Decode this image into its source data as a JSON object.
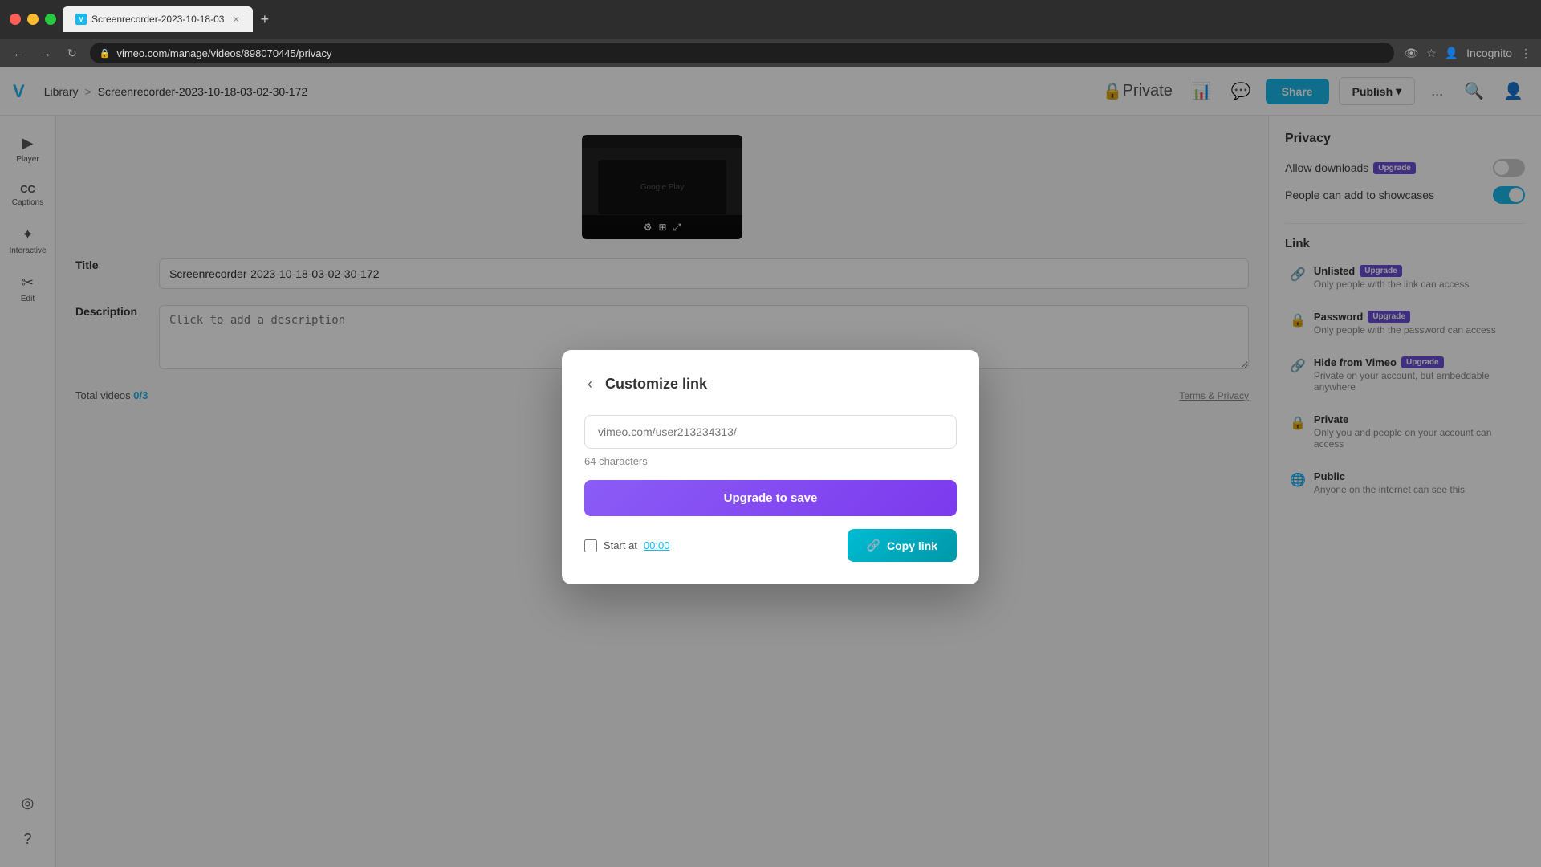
{
  "browser": {
    "tab_title": "Screenrecorder-2023-10-18-03",
    "tab_favicon": "V",
    "address": "vimeo.com/manage/videos/898070445/privacy",
    "new_tab_label": "+"
  },
  "vimeo": {
    "logo": "V",
    "breadcrumb": {
      "library": "Library",
      "separator": ">",
      "current": "Screenrecorder-2023-10-18-03-02-30-172"
    },
    "nav": {
      "private_label": "Private",
      "share_label": "Share",
      "publish_label": "Publish",
      "more_label": "..."
    },
    "sidebar": [
      {
        "id": "player",
        "icon": "▶",
        "label": "Player"
      },
      {
        "id": "captions",
        "icon": "CC",
        "label": "Captions"
      },
      {
        "id": "interactive",
        "icon": "✦",
        "label": "Interactive"
      },
      {
        "id": "edit",
        "icon": "✂",
        "label": "Edit"
      },
      {
        "id": "compass",
        "icon": "◎",
        "label": ""
      },
      {
        "id": "help",
        "icon": "?",
        "label": ""
      }
    ],
    "form": {
      "title_label": "Title",
      "title_value": "Screenrecorder-2023-10-18-03-02-30-172",
      "description_label": "Description",
      "description_placeholder": "Click to add a description",
      "total_videos_label": "Total videos",
      "total_count": "0/3",
      "terms_label": "Terms & Privacy"
    },
    "privacy_panel": {
      "title": "Privacy",
      "allow_downloads_label": "Allow downloads",
      "allow_downloads_badge": "Upgrade",
      "allow_downloads_toggle": "off",
      "people_showcases_label": "People can add to showcases",
      "people_showcases_toggle": "on",
      "link_title": "Link",
      "link_options": [
        {
          "id": "unlisted",
          "icon": "🔗",
          "title": "Unlisted",
          "badge": "Upgrade",
          "description": "Only people with the link can access"
        },
        {
          "id": "password",
          "icon": "🔒",
          "title": "Password",
          "badge": "Upgrade",
          "description": "Only people with the password can access"
        },
        {
          "id": "hide-from-vimeo",
          "icon": "🔗",
          "title": "Hide from Vimeo",
          "badge": "Upgrade",
          "description": "Private on your account, but embeddable anywhere"
        },
        {
          "id": "private",
          "icon": "🔒",
          "title": "Private",
          "description": "Only you and people on your account can access"
        },
        {
          "id": "public",
          "icon": "🌐",
          "title": "Public",
          "description": "Anyone on the internet can see this"
        }
      ]
    },
    "modal": {
      "title": "Customize link",
      "back_icon": "‹",
      "input_placeholder": "vimeo.com/user213234313/",
      "char_count": "64 characters",
      "upgrade_btn": "Upgrade to save",
      "start_at_label": "Start at",
      "start_at_time": "00:00",
      "copy_link_btn": "Copy link",
      "copy_icon": "🔗"
    }
  }
}
